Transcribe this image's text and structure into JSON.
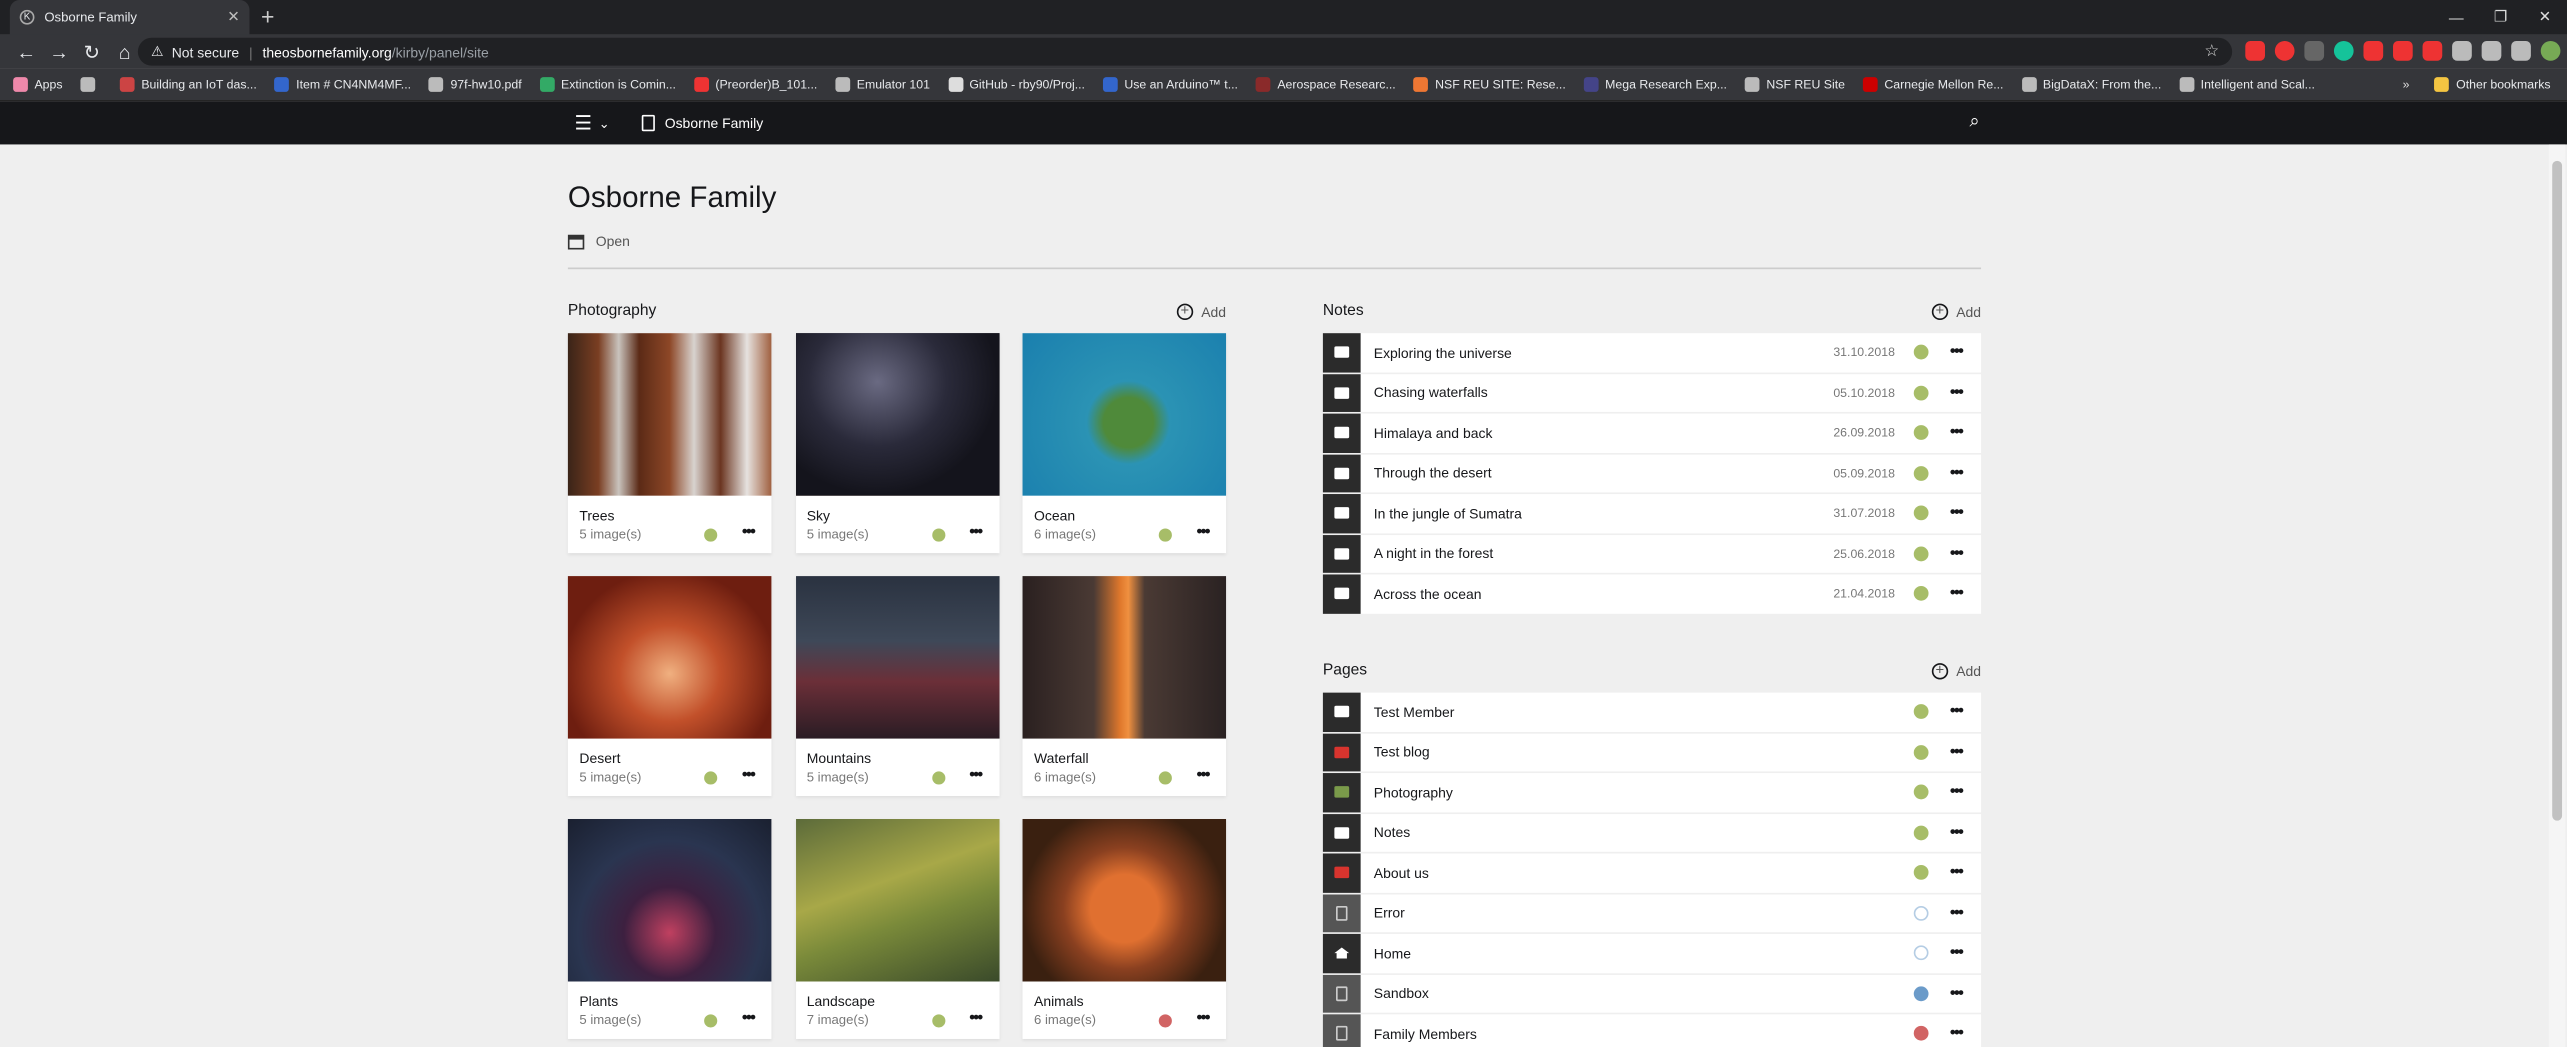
{
  "browser": {
    "tab_title": "Osborne Family",
    "security": "Not secure",
    "url_host": "theosbornefamily.org",
    "url_path": "/kirby/panel/site",
    "bookmarks": [
      "Apps",
      "",
      "Building an IoT das...",
      "Item # CN4NM4MF...",
      "97f-hw10.pdf",
      "Extinction is Comin...",
      "(Preorder)B_101...",
      "Emulator 101",
      "GitHub - rby90/Proj...",
      "Use an Arduino™ t...",
      "Aerospace Researc...",
      "NSF REU SITE: Rese...",
      "Mega Research Exp...",
      "NSF REU Site",
      "Carnegie Mellon Re...",
      "BigDataX: From the...",
      "Intelligent and Scal..."
    ],
    "other_bookmarks": "Other bookmarks"
  },
  "topbar": {
    "site_label": "Osborne Family"
  },
  "page": {
    "title": "Osborne Family",
    "open_label": "Open"
  },
  "photography": {
    "heading": "Photography",
    "add_label": "Add",
    "cards": [
      {
        "name": "Trees",
        "count": "5 image(s)",
        "status": "#a7bd68"
      },
      {
        "name": "Sky",
        "count": "5 image(s)",
        "status": "#a7bd68"
      },
      {
        "name": "Ocean",
        "count": "6 image(s)",
        "status": "#a7bd68"
      },
      {
        "name": "Desert",
        "count": "5 image(s)",
        "status": "#a7bd68"
      },
      {
        "name": "Mountains",
        "count": "5 image(s)",
        "status": "#a7bd68"
      },
      {
        "name": "Waterfall",
        "count": "6 image(s)",
        "status": "#a7bd68"
      },
      {
        "name": "Plants",
        "count": "5 image(s)",
        "status": "#a7bd68"
      },
      {
        "name": "Landscape",
        "count": "7 image(s)",
        "status": "#a7bd68"
      },
      {
        "name": "Animals",
        "count": "6 image(s)",
        "status": "#d16464"
      }
    ]
  },
  "notes": {
    "heading": "Notes",
    "add_label": "Add",
    "items": [
      {
        "title": "Exploring the universe",
        "date": "31.10.2018"
      },
      {
        "title": "Chasing waterfalls",
        "date": "05.10.2018"
      },
      {
        "title": "Himalaya and back",
        "date": "26.09.2018"
      },
      {
        "title": "Through the desert",
        "date": "05.09.2018"
      },
      {
        "title": "In the jungle of Sumatra",
        "date": "31.07.2018"
      },
      {
        "title": "A night in the forest",
        "date": "25.06.2018"
      },
      {
        "title": "Across the ocean",
        "date": "21.04.2018"
      }
    ]
  },
  "pages": {
    "heading": "Pages",
    "add_label": "Add",
    "items": [
      {
        "title": "Test Member",
        "status": "listed"
      },
      {
        "title": "Test blog",
        "status": "listed"
      },
      {
        "title": "Photography",
        "status": "listed"
      },
      {
        "title": "Notes",
        "status": "listed"
      },
      {
        "title": "About us",
        "status": "listed"
      },
      {
        "title": "Error",
        "status": "draft"
      },
      {
        "title": "Home",
        "status": "draft"
      },
      {
        "title": "Sandbox",
        "status": "unlisted"
      },
      {
        "title": "Family Members",
        "status": "private"
      }
    ]
  },
  "colors": {
    "listed": "#a7bd68",
    "unlisted": "#6b9bc9",
    "private": "#d16464",
    "draft": "#b5cde4"
  }
}
